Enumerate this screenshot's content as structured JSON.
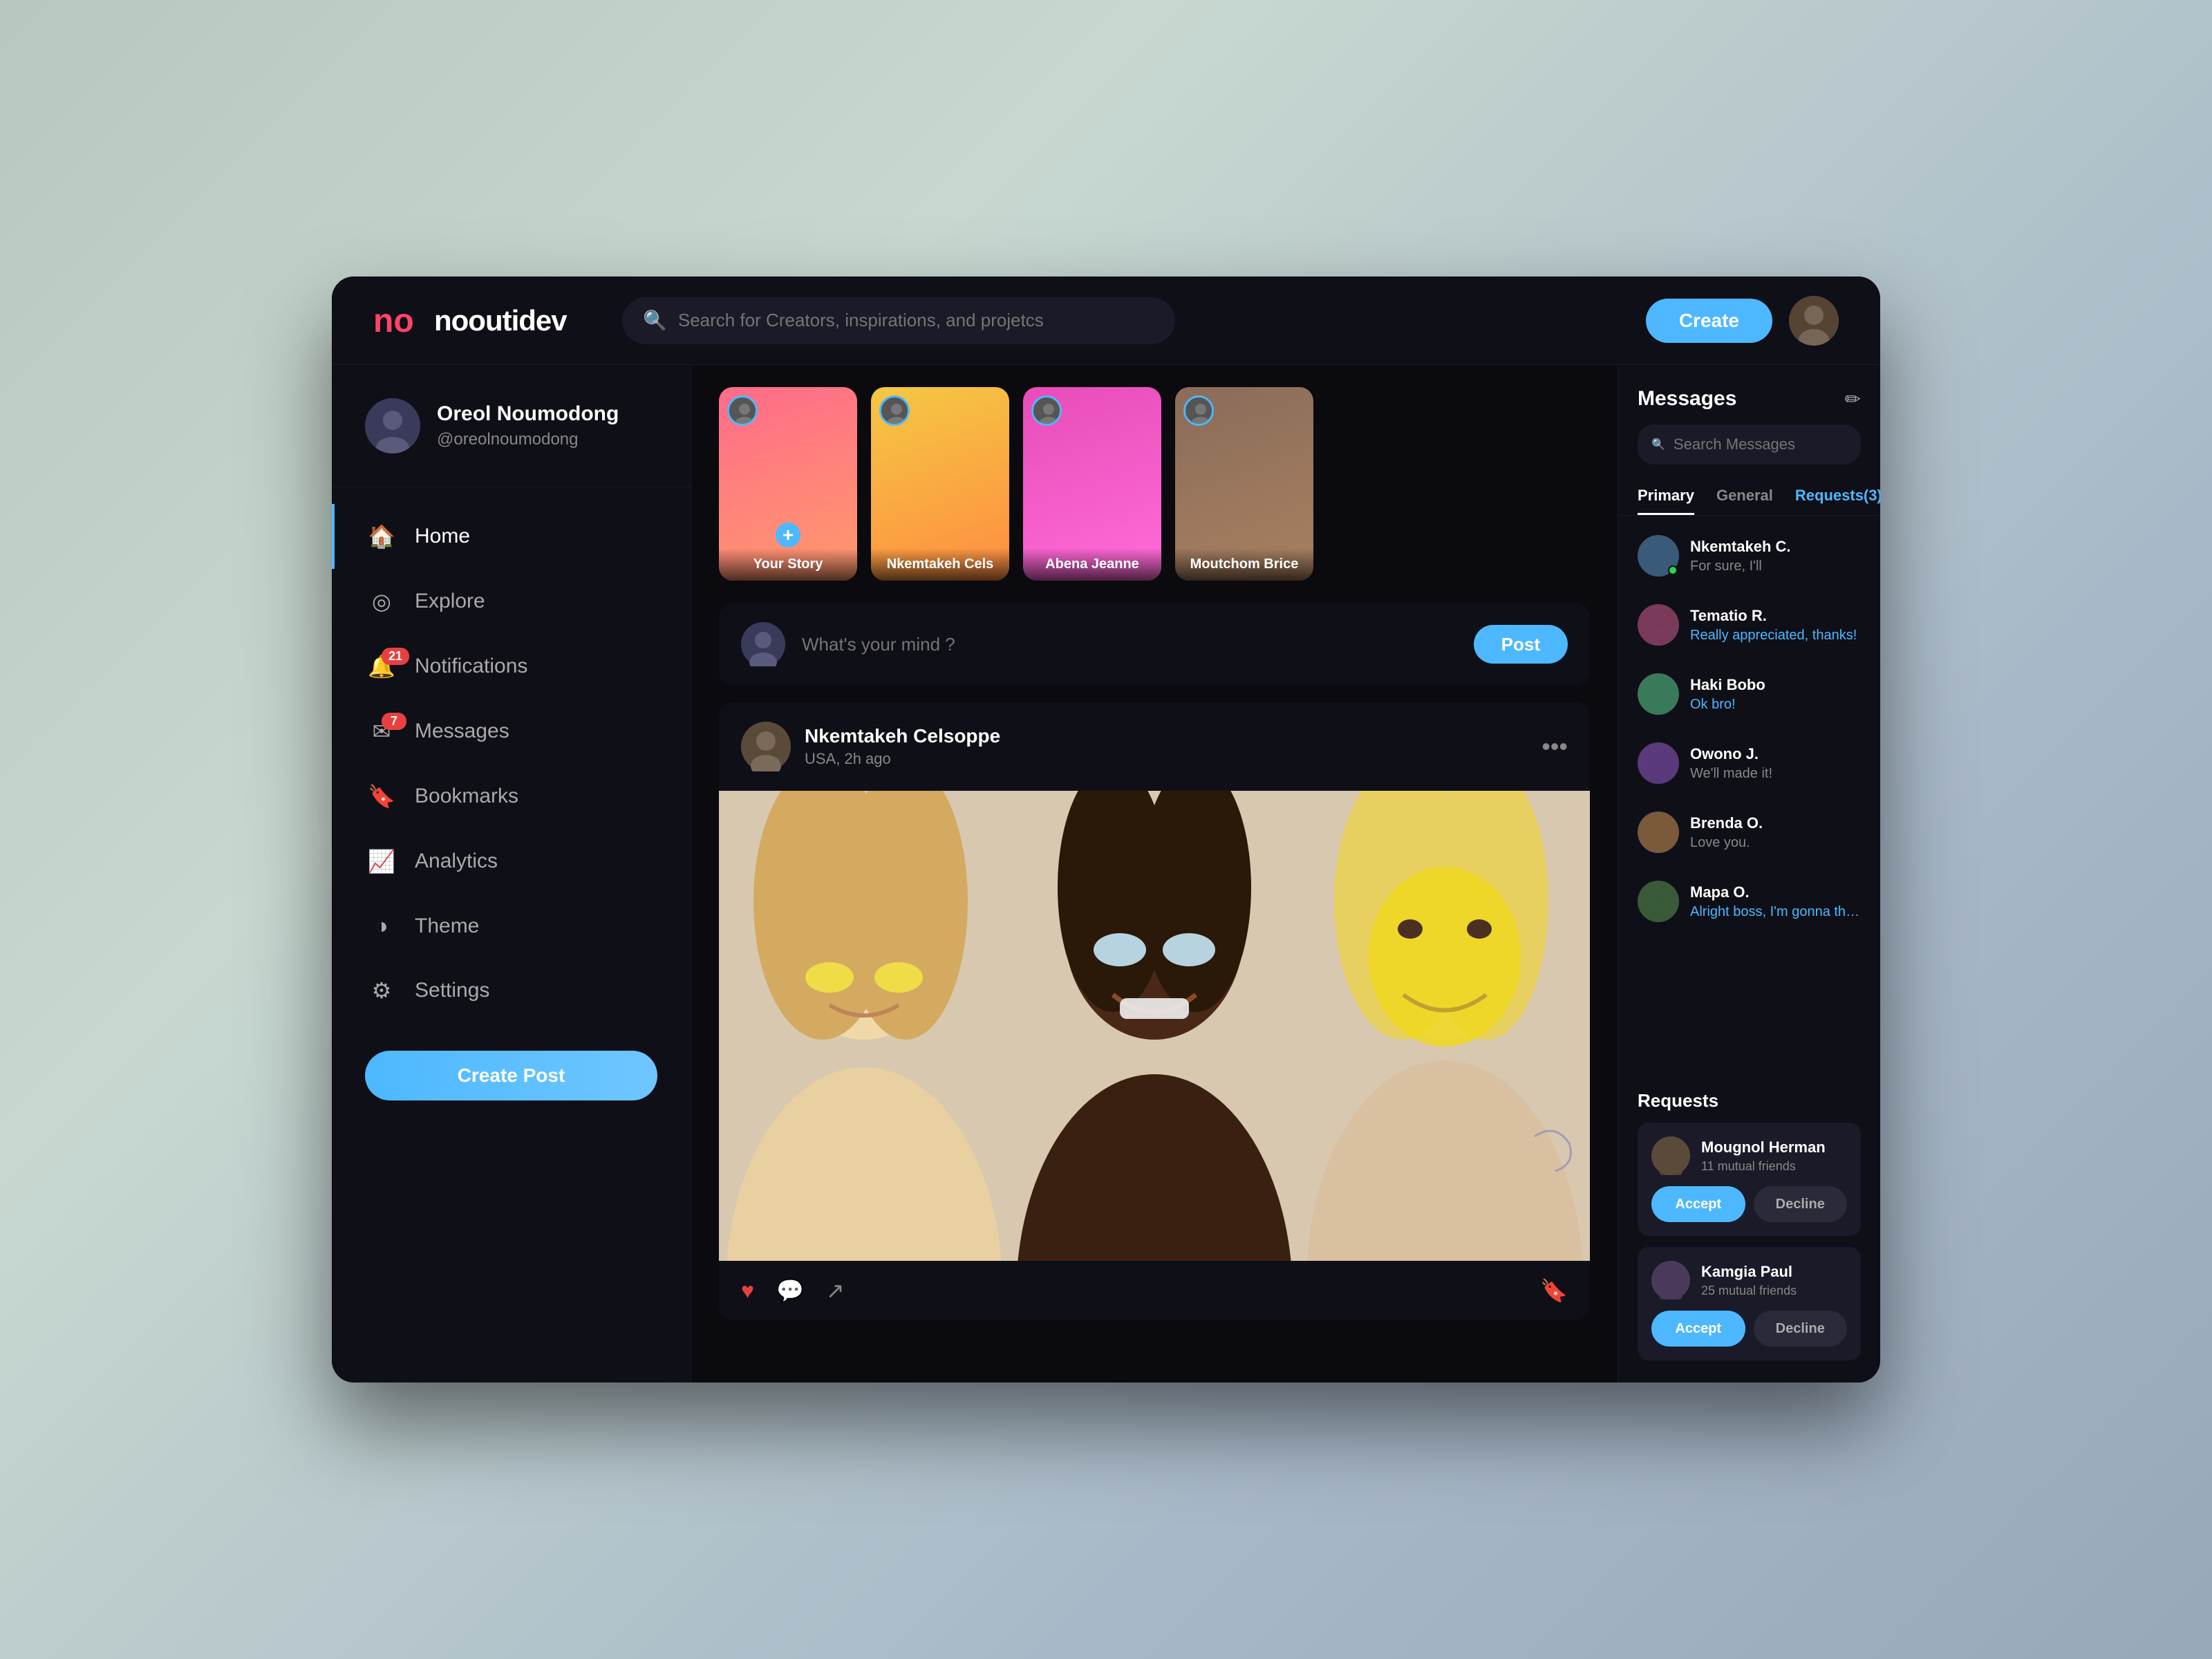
{
  "app": {
    "name": "nooutidev",
    "logo_text": "nooutidev"
  },
  "header": {
    "search_placeholder": "Search for Creators, inspirations, and projetcs",
    "create_label": "Create"
  },
  "sidebar": {
    "user": {
      "name": "Oreol Noumodong",
      "handle": "@oreolnoumodong"
    },
    "nav": [
      {
        "id": "home",
        "label": "Home",
        "icon": "🏠",
        "active": true,
        "badge": null
      },
      {
        "id": "explore",
        "label": "Explore",
        "icon": "◎",
        "active": false,
        "badge": null
      },
      {
        "id": "notifications",
        "label": "Notifications",
        "icon": "🔔",
        "active": false,
        "badge": "21"
      },
      {
        "id": "messages",
        "label": "Messages",
        "icon": "✉",
        "active": false,
        "badge": "7"
      },
      {
        "id": "bookmarks",
        "label": "Bookmarks",
        "icon": "🔖",
        "active": false,
        "badge": null
      },
      {
        "id": "analytics",
        "label": "Analytics",
        "icon": "📈",
        "active": false,
        "badge": null
      },
      {
        "id": "theme",
        "label": "Theme",
        "icon": "◑",
        "active": false,
        "badge": null
      },
      {
        "id": "settings",
        "label": "Settings",
        "icon": "⚙",
        "active": false,
        "badge": null
      }
    ],
    "create_post_label": "Create Post"
  },
  "stories": [
    {
      "id": 1,
      "name": "Your Story",
      "bg_class": "story-1-bg",
      "has_plus": true
    },
    {
      "id": 2,
      "name": "Nkemtakeh Cels",
      "bg_class": "story-2-bg",
      "has_plus": false
    },
    {
      "id": 3,
      "name": "Abena Jeanne",
      "bg_class": "story-3-bg",
      "has_plus": false
    },
    {
      "id": 4,
      "name": "Moutchom Brice",
      "bg_class": "story-4-bg",
      "has_plus": false
    }
  ],
  "composer": {
    "placeholder": "What's your mind ?",
    "post_label": "Post"
  },
  "posts": [
    {
      "id": 1,
      "author": "Nkemtakeh Celsoppe",
      "meta": "USA, 2h ago",
      "liked": true
    }
  ],
  "messages": {
    "title": "Messages",
    "search_placeholder": "Search Messages",
    "tabs": [
      {
        "id": "primary",
        "label": "Primary",
        "active": true
      },
      {
        "id": "general",
        "label": "General",
        "active": false
      },
      {
        "id": "requests",
        "label": "Requests(3)",
        "active": false,
        "highlighted": true
      }
    ],
    "conversations": [
      {
        "id": 1,
        "name": "Nkemtakeh C.",
        "preview": "For sure, I'll",
        "online": true,
        "highlighted": false
      },
      {
        "id": 2,
        "name": "Tematio R.",
        "preview": "Really appreciated, thanks!",
        "online": false,
        "highlighted": true
      },
      {
        "id": 3,
        "name": "Haki Bobo",
        "preview": "Ok bro!",
        "online": false,
        "highlighted": true
      },
      {
        "id": 4,
        "name": "Owono J.",
        "preview": "We'll made it!",
        "online": false,
        "highlighted": false
      },
      {
        "id": 5,
        "name": "Brenda O.",
        "preview": "Love you.",
        "online": false,
        "highlighted": false
      },
      {
        "id": 6,
        "name": "Mapa O.",
        "preview": "Alright boss, I'm gonna the US by tonigh...",
        "online": false,
        "highlighted": true
      }
    ],
    "requests_title": "Requests",
    "requests": [
      {
        "id": 1,
        "name": "Mougnol Herman",
        "mutual": "11 mutual friends"
      },
      {
        "id": 2,
        "name": "Kamgia Paul",
        "mutual": "25 mutual friends"
      }
    ],
    "accept_label": "Accept",
    "decline_label": "Decline"
  }
}
